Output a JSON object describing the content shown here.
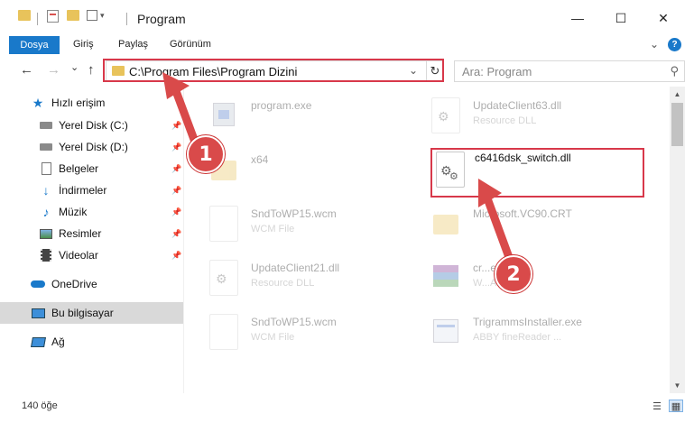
{
  "window": {
    "title": "Program",
    "minimize_glyph": "—",
    "maximize_glyph": "☐",
    "close_glyph": "✕"
  },
  "ribbon": {
    "tabs": [
      "Dosya",
      "Giriş",
      "Paylaş",
      "Görünüm"
    ],
    "help_glyph": "?",
    "expand_glyph": "⌄"
  },
  "navigation": {
    "back_glyph": "←",
    "forward_glyph": "→",
    "recent_glyph": "⌄",
    "up_glyph": "↑",
    "address": "C:\\Program Files\\Program Dizini",
    "address_dropdown_glyph": "⌄",
    "refresh_glyph": "↻",
    "search_placeholder": "Ara: Program",
    "search_glyph": "⚲"
  },
  "sidebar": {
    "quick_access": "Hızlı erişim",
    "items": [
      {
        "label": "Yerel Disk (C:)",
        "icon": "drive-icon"
      },
      {
        "label": "Yerel Disk (D:)",
        "icon": "drive-icon"
      },
      {
        "label": "Belgeler",
        "icon": "documents-icon"
      },
      {
        "label": "İndirmeler",
        "icon": "downloads-icon"
      },
      {
        "label": "Müzik",
        "icon": "music-icon"
      },
      {
        "label": "Resimler",
        "icon": "pictures-icon"
      },
      {
        "label": "Videolar",
        "icon": "videos-icon"
      }
    ],
    "onedrive": "OneDrive",
    "this_pc": "Bu bilgisayar",
    "network": "Ağ",
    "pin_glyph": "📌"
  },
  "files": [
    {
      "name": "program.exe",
      "type": "",
      "icon": "exe-icon",
      "faded": true
    },
    {
      "name": "UpdateClient63.dll",
      "type": "Resource DLL",
      "icon": "dll-icon",
      "faded": true
    },
    {
      "name": "x64",
      "type": "",
      "icon": "folder-icon",
      "faded": true
    },
    {
      "name": "c6416dsk_switch.dll",
      "type": "",
      "icon": "dll-icon",
      "faded": false
    },
    {
      "name": "SndToWP15.wcm",
      "type": "WCM File",
      "icon": "file-icon",
      "faded": true
    },
    {
      "name": "Microsoft.VC90.CRT",
      "type": "",
      "icon": "folder-icon",
      "faded": true
    },
    {
      "name": "UpdateClient21.dll",
      "type": "Resource DLL",
      "icon": "dll-icon",
      "faded": true
    },
    {
      "name": "cr...es.cab",
      "type": "W...Archive",
      "icon": "archive-icon",
      "faded": true
    },
    {
      "name": "SndToWP15.wcm",
      "type": "WCM File",
      "icon": "file-icon",
      "faded": true
    },
    {
      "name": "TrigrammsInstaller.exe",
      "type": "ABBY fineReader ...",
      "icon": "exe-icon",
      "faded": true
    }
  ],
  "badges": [
    "1",
    "2"
  ],
  "status": {
    "count": "140 öğe"
  },
  "colors": {
    "accent": "#1979ca",
    "highlight": "#d8384a"
  }
}
